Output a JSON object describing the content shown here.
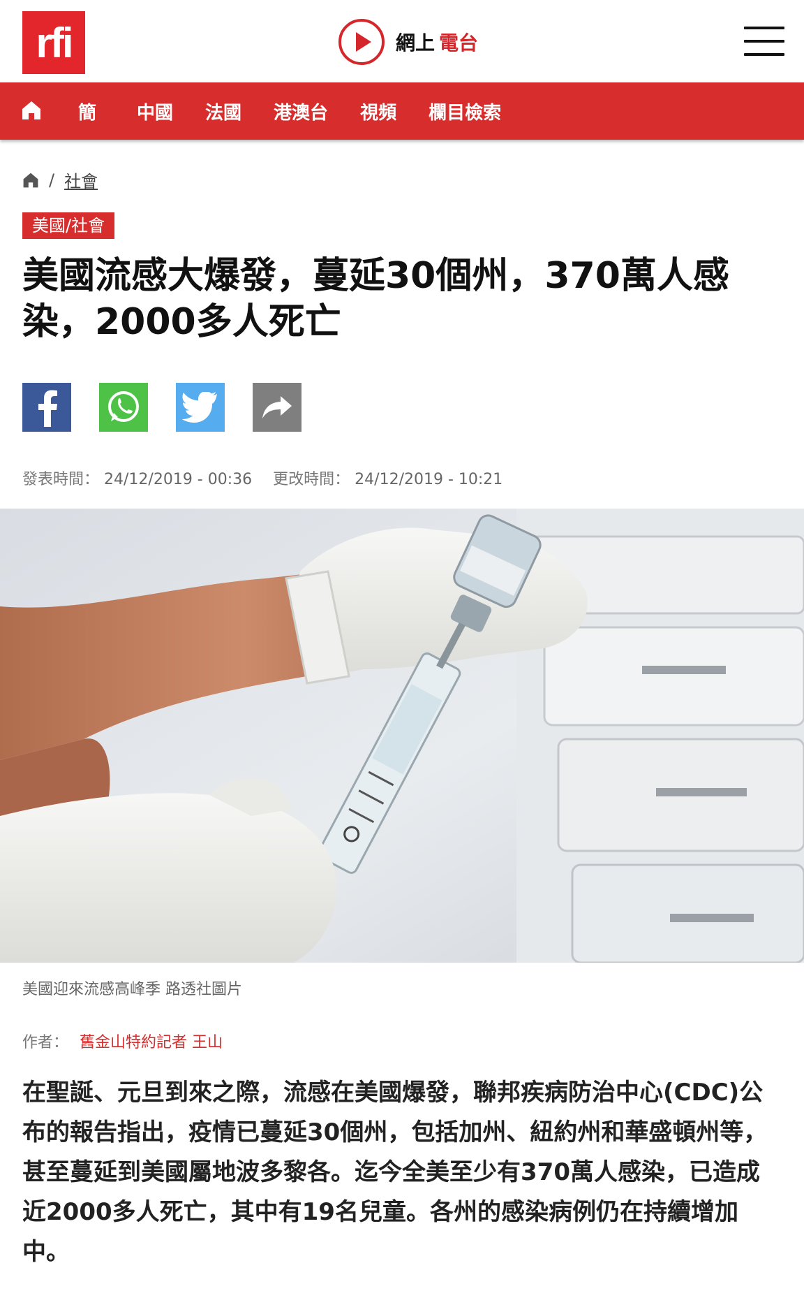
{
  "header": {
    "logo_text": "rfi",
    "radio_label": "網上",
    "radio_accent": "電台",
    "brand_color": "#d82d2d"
  },
  "nav": {
    "items": [
      {
        "label": "簡"
      },
      {
        "label": "中國"
      },
      {
        "label": "法國"
      },
      {
        "label": "港澳台"
      },
      {
        "label": "視頻"
      },
      {
        "label": "欄目檢索"
      }
    ]
  },
  "breadcrumb": {
    "separator": "/",
    "section": "社會"
  },
  "article": {
    "tag": "美國/社會",
    "title": "美國流感大爆發，蔓延30個州，370萬人感染，2000多人死亡",
    "published_label": "發表時間：",
    "published_value": "24/12/2019 - 00:36",
    "updated_label": "更改時間：",
    "updated_value": "24/12/2019 - 10:21",
    "photo_caption": "美國迎來流感高峰季 路透社圖片",
    "author_label": "作者：",
    "author_name": "舊金山特約記者 王山",
    "lead": "在聖誕、元旦到來之際，流感在美國爆發，聯邦疾病防治中心(CDC)公布的報告指出，疫情已蔓延30個州，包括加州、紐約州和華盛頓州等，甚至蔓延到美國屬地波多黎各。迄今全美至少有370萬人感染，已造成近2000多人死亡，其中有19名兒童。各州的感染病例仍在持續增加中。"
  },
  "share": {
    "icons": [
      "facebook-icon",
      "whatsapp-icon",
      "twitter-icon",
      "share-icon"
    ],
    "colors": {
      "facebook": "#3b5998",
      "whatsapp": "#4dc247",
      "twitter": "#55acee",
      "share": "#7f7f7f"
    }
  }
}
